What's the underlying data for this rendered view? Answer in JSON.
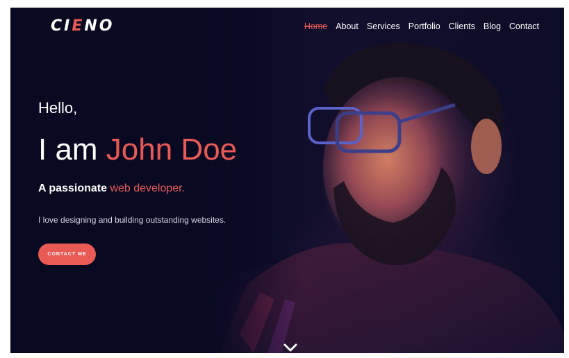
{
  "logo": {
    "first": "CI",
    "accent": "E",
    "last": "NO"
  },
  "nav": {
    "items": [
      {
        "label": "Home",
        "active": true
      },
      {
        "label": "About"
      },
      {
        "label": "Services"
      },
      {
        "label": "Portfolio"
      },
      {
        "label": "Clients"
      },
      {
        "label": "Blog"
      },
      {
        "label": "Contact"
      }
    ]
  },
  "hero": {
    "greeting": "Hello,",
    "intro": "I am ",
    "name": "John Doe",
    "tagline_prefix": "A passionate ",
    "tagline_highlight": "web developer.",
    "description": "I love designing and building outstanding websites.",
    "cta_label": "CONTACT ME"
  },
  "icons": {
    "scroll": "chevron-down-icon"
  },
  "colors": {
    "accent": "#ea5a55",
    "background": "#0b0b26",
    "text": "#ffffff"
  }
}
